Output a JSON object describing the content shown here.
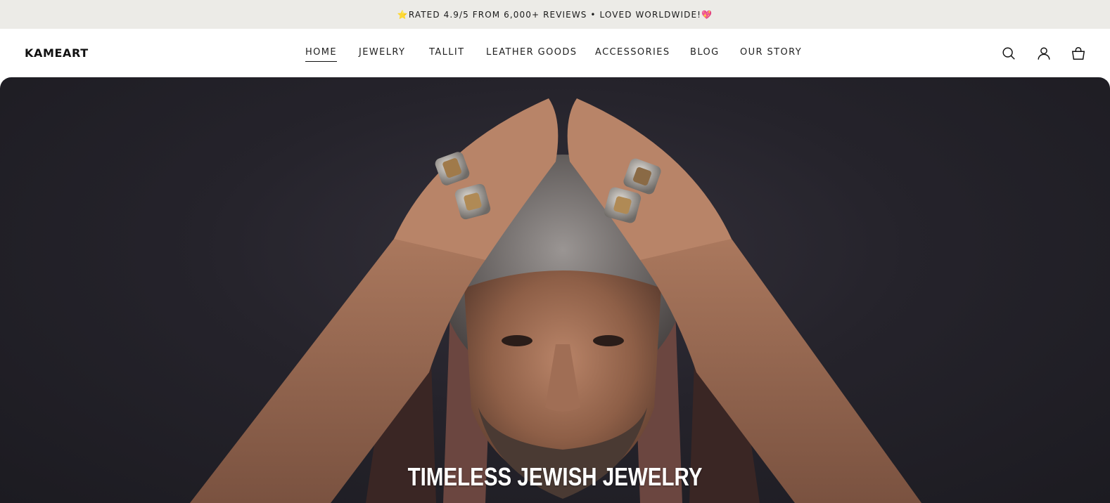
{
  "announcement": {
    "star_emoji": "⭐",
    "text": "RATED 4.9/5 FROM 6,000+ REVIEWS • LOVED WORLDWIDE!",
    "heart_emoji": "💖"
  },
  "header": {
    "logo": "KAMEART",
    "nav": [
      {
        "label": "HOME",
        "active": true
      },
      {
        "label": "JEWELRY",
        "active": false
      },
      {
        "label": "TALLIT",
        "active": false
      },
      {
        "label": "LEATHER GOODS",
        "active": false
      },
      {
        "label": "ACCESSORIES",
        "active": false
      },
      {
        "label": "BLOG",
        "active": false
      },
      {
        "label": "OUR STORY",
        "active": false
      }
    ],
    "icons": [
      "search-icon",
      "account-icon",
      "cart-icon"
    ]
  },
  "hero": {
    "title": "TIMELESS JEWISH JEWELRY",
    "image": "man-with-rings-and-tallit"
  },
  "colors": {
    "announcement_bg": "#ecebe7",
    "hero_bg": "#25232b",
    "text": "#111111"
  }
}
